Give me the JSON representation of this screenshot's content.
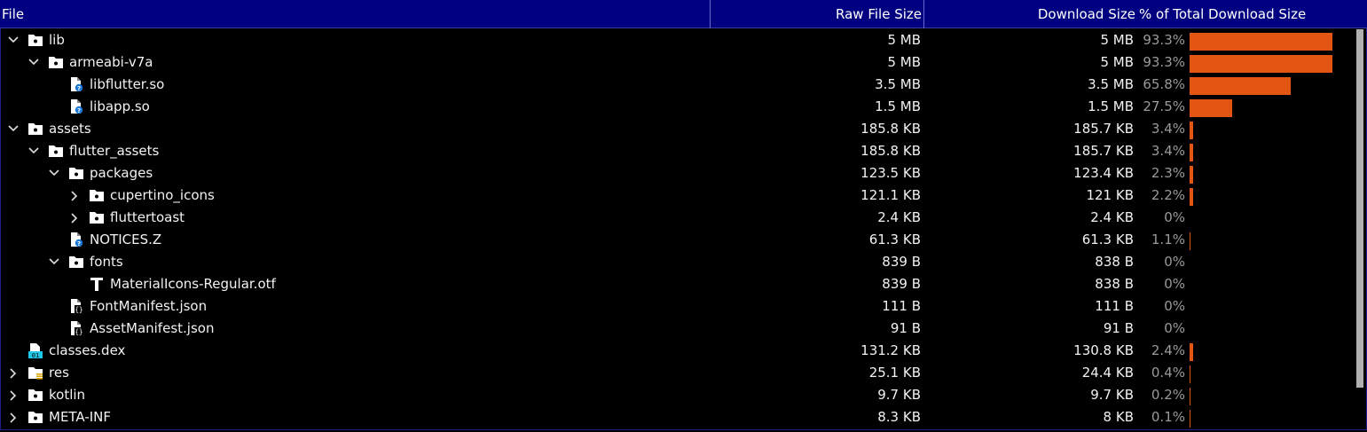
{
  "columns": {
    "file": "File",
    "raw": "Raw File Size",
    "download": "Download Size",
    "percent": "% of Total Download Size"
  },
  "rows": [
    {
      "name": "lib",
      "icon": "folder",
      "expander": "expanded",
      "raw": "5 MB",
      "download": "5 MB",
      "percent": "93.3%",
      "share": 93.3
    },
    {
      "name": "armeabi-v7a",
      "icon": "folder",
      "expander": "expanded",
      "raw": "5 MB",
      "download": "5 MB",
      "percent": "93.3%",
      "share": 93.3
    },
    {
      "name": "libflutter.so",
      "icon": "unknown-file",
      "expander": "none",
      "raw": "3.5 MB",
      "download": "3.5 MB",
      "percent": "65.8%",
      "share": 65.8
    },
    {
      "name": "libapp.so",
      "icon": "unknown-file",
      "expander": "none",
      "raw": "1.5 MB",
      "download": "1.5 MB",
      "percent": "27.5%",
      "share": 27.5
    },
    {
      "name": "assets",
      "icon": "folder",
      "expander": "expanded",
      "raw": "185.8 KB",
      "download": "185.7 KB",
      "percent": "3.4%",
      "share": 3.4
    },
    {
      "name": "flutter_assets",
      "icon": "folder",
      "expander": "expanded",
      "raw": "185.8 KB",
      "download": "185.7 KB",
      "percent": "3.4%",
      "share": 3.4
    },
    {
      "name": "packages",
      "icon": "folder",
      "expander": "expanded",
      "raw": "123.5 KB",
      "download": "123.4 KB",
      "percent": "2.3%",
      "share": 2.3
    },
    {
      "name": "cupertino_icons",
      "icon": "folder",
      "expander": "collapsed",
      "raw": "121.1 KB",
      "download": "121 KB",
      "percent": "2.2%",
      "share": 2.2
    },
    {
      "name": "fluttertoast",
      "icon": "folder",
      "expander": "collapsed",
      "raw": "2.4 KB",
      "download": "2.4 KB",
      "percent": "0%",
      "share": 0
    },
    {
      "name": "NOTICES.Z",
      "icon": "unknown-file",
      "expander": "none",
      "raw": "61.3 KB",
      "download": "61.3 KB",
      "percent": "1.1%",
      "share": 1.1
    },
    {
      "name": "fonts",
      "icon": "folder",
      "expander": "expanded",
      "raw": "839 B",
      "download": "838 B",
      "percent": "0%",
      "share": 0
    },
    {
      "name": "MaterialIcons-Regular.otf",
      "icon": "font-file",
      "expander": "none",
      "raw": "839 B",
      "download": "838 B",
      "percent": "0%",
      "share": 0
    },
    {
      "name": "FontManifest.json",
      "icon": "json-file",
      "expander": "none",
      "raw": "111 B",
      "download": "111 B",
      "percent": "0%",
      "share": 0
    },
    {
      "name": "AssetManifest.json",
      "icon": "json-file",
      "expander": "none",
      "raw": "91 B",
      "download": "91 B",
      "percent": "0%",
      "share": 0
    },
    {
      "name": "classes.dex",
      "icon": "dex-file",
      "expander": "none",
      "raw": "131.2 KB",
      "download": "130.8 KB",
      "percent": "2.4%",
      "share": 2.4
    },
    {
      "name": "res",
      "icon": "res-folder",
      "expander": "collapsed",
      "raw": "25.1 KB",
      "download": "24.4 KB",
      "percent": "0.4%",
      "share": 0.4
    },
    {
      "name": "kotlin",
      "icon": "folder",
      "expander": "collapsed",
      "raw": "9.7 KB",
      "download": "9.7 KB",
      "percent": "0.2%",
      "share": 0.2
    },
    {
      "name": "META-INF",
      "icon": "folder",
      "expander": "collapsed",
      "raw": "8.3 KB",
      "download": "8 KB",
      "percent": "0.1%",
      "share": 0.1
    }
  ],
  "colors": {
    "header_bg": "#000080",
    "bar": "#e35512",
    "percent_text": "#9a9a9a",
    "dex_icon": "#1ec8e6",
    "res_icon": "#d9a500"
  }
}
